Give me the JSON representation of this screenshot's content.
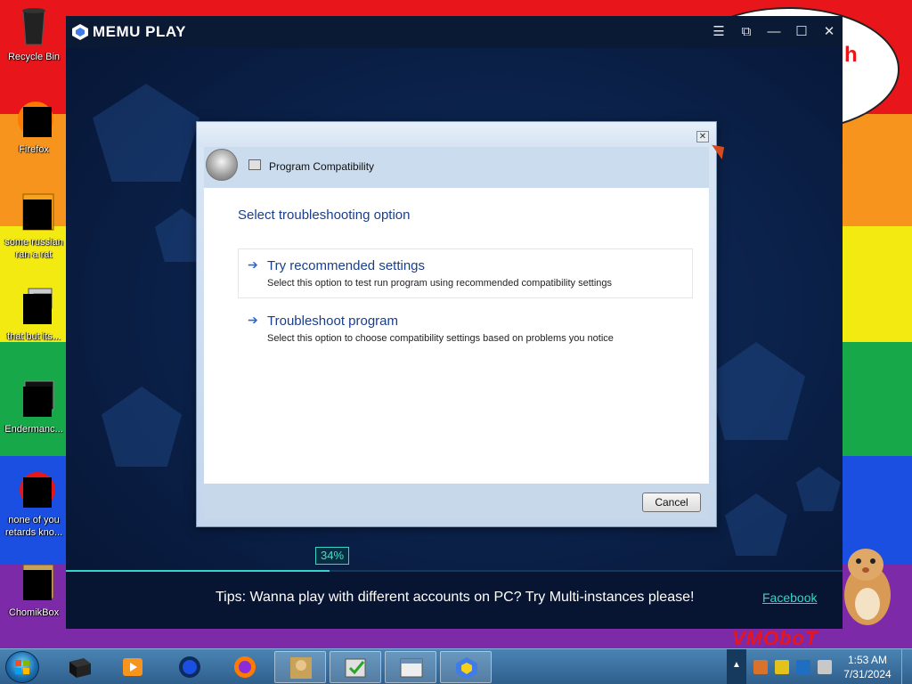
{
  "desktop": {
    "icons": [
      {
        "label": "Recycle Bin",
        "icon": "recycle-bin-icon"
      },
      {
        "label": "Firefox",
        "icon": "firefox-icon"
      },
      {
        "label": "some russian ran a rat",
        "icon": "program-icon"
      },
      {
        "label": "that but its...",
        "icon": "folder-icon"
      },
      {
        "label": "Endermanc...",
        "icon": "app-icon"
      },
      {
        "label": "none of you retards kno...",
        "icon": "opera-icon"
      },
      {
        "label": "ChomikBox",
        "icon": "chomikbox-icon"
      }
    ],
    "bubble_text": "h",
    "wall_label": "VMOboT"
  },
  "memu": {
    "title": "MEMU PLAY",
    "controls": {
      "menu": "☰",
      "snapshot": "⧉",
      "minimize": "—",
      "maximize": "☐",
      "close": "✕"
    },
    "progress": {
      "label": "34%",
      "value": 34
    },
    "tips": "Tips: Wanna play with different accounts on PC? Try Multi-instances please!",
    "link": "Facebook"
  },
  "dialog": {
    "title": "Program Compatibility",
    "close": "✕",
    "heading": "Select troubleshooting option",
    "options": [
      {
        "title": "Try recommended settings",
        "desc": "Select this option to test run program using recommended compatibility settings"
      },
      {
        "title": "Troubleshoot program",
        "desc": "Select this option to choose compatibility settings based on problems you notice"
      }
    ],
    "cancel": "Cancel"
  },
  "taskbar": {
    "time": "1:53 AM",
    "date": "7/31/2024"
  },
  "colors": {
    "accent": "#35d5c9",
    "link_blue": "#1a3e8c"
  }
}
